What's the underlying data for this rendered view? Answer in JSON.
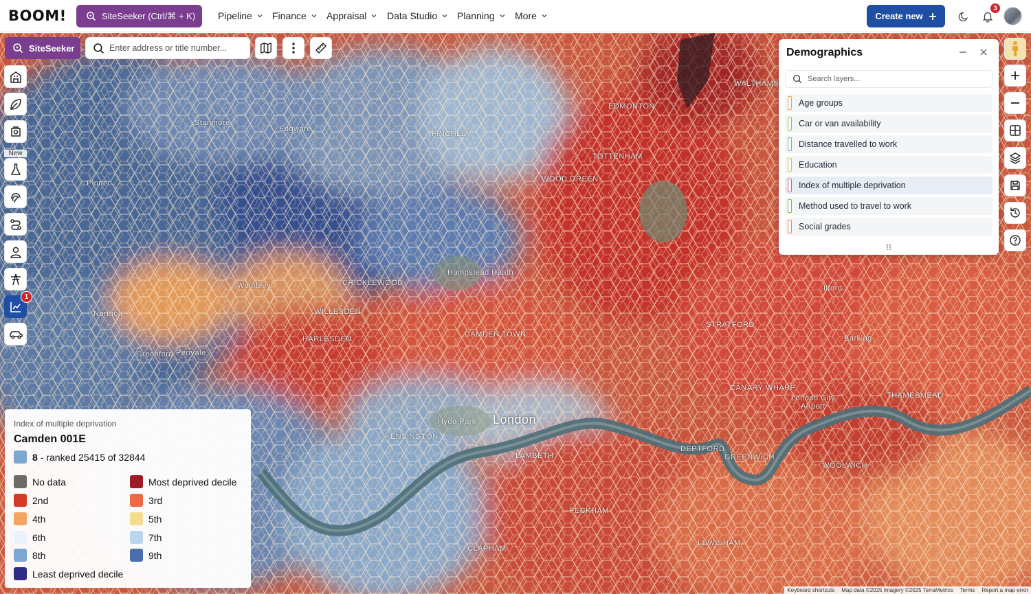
{
  "header": {
    "logo": "BOOM!",
    "siteseeker_button": "SiteSeeker (Ctrl/⌘ + K)",
    "nav": [
      {
        "label": "Pipeline"
      },
      {
        "label": "Finance"
      },
      {
        "label": "Appraisal"
      },
      {
        "label": "Data Studio"
      },
      {
        "label": "Planning"
      },
      {
        "label": "More"
      }
    ],
    "create_button": "Create new",
    "notifications_count": "3"
  },
  "map_toolbar": {
    "siteseeker_label": "SiteSeeker",
    "search_placeholder": "Enter address or title number..."
  },
  "left_rail": {
    "new_label": "New",
    "active_badge": "1"
  },
  "map": {
    "labels": {
      "london": "London",
      "wembley": "Wembley",
      "hyde_park": "Hyde Park",
      "tottenham": "TOTTENHAM",
      "stratford": "STRATFORD",
      "camden_town": "CAMDEN TOWN",
      "edmonton": "EDMONTON",
      "walthamstow": "WALTHAMSTOW",
      "greenwich": "GREENWICH",
      "woolwich": "WOOLWICH",
      "harlesden": "HARLESDEN",
      "willesden": "WILLESDEN",
      "wood_green": "WOOD GREEN",
      "hampstead_heath": "Hampstead Heath",
      "cricklewood": "CRICKLEWOOD",
      "northolt": "Northolt",
      "greenford": "Greenford",
      "perivale": "Perivale",
      "stanmore": "Stanmore",
      "edgware": "Edgware",
      "pinner": "Pinner",
      "finchley": "FINCHLEY",
      "barking": "Barking",
      "ilford": "Ilford",
      "kensington": "KENSINGTON",
      "lambeth": "LAMBETH",
      "deptford": "DEPTFORD",
      "lewisham": "LEWISHAM",
      "clapham": "CLAPHAM",
      "peckham": "PECKHAM",
      "canary_wharf": "CANARY WHARF",
      "city_airport": "London City Airport",
      "thamesmead": "THAMESMEAD"
    },
    "attribution": {
      "shortcuts": "Keyboard shortcuts",
      "data": "Map data ©2025 Imagery ©2025 TerraMetrics",
      "terms": "Terms",
      "report": "Report a map error"
    }
  },
  "demographics_panel": {
    "title": "Demographics",
    "search_placeholder": "Search layers...",
    "layers": [
      {
        "label": "Age groups",
        "color": "#f0a340"
      },
      {
        "label": "Car or van availability",
        "color": "#8cc63f"
      },
      {
        "label": "Distance travelled to work",
        "color": "#5fb89a"
      },
      {
        "label": "Education",
        "color": "#e8b74a"
      },
      {
        "label": "Index of multiple deprivation",
        "color": "#e0605a"
      },
      {
        "label": "Method used to travel to work",
        "color": "#6cc24a"
      },
      {
        "label": "Social grades",
        "color": "#f08a3c"
      }
    ]
  },
  "legend": {
    "subtitle": "Index of multiple deprivation",
    "area": "Camden 001E",
    "decile": "8",
    "rank_text": "- ranked 25415 of 32844",
    "rank_color": "#7ba7d0",
    "items": [
      {
        "label": "No data",
        "color": "#6f6a66"
      },
      {
        "label": "Most deprived decile",
        "color": "#9b1c24"
      },
      {
        "label": "2nd",
        "color": "#d23a2a"
      },
      {
        "label": "3rd",
        "color": "#ec6a44"
      },
      {
        "label": "4th",
        "color": "#f4a561"
      },
      {
        "label": "5th",
        "color": "#f8dc8e"
      },
      {
        "label": "6th",
        "color": "#eaf3fb"
      },
      {
        "label": "7th",
        "color": "#b9d6ee"
      },
      {
        "label": "8th",
        "color": "#7ba7d0"
      },
      {
        "label": "9th",
        "color": "#4a6fae"
      },
      {
        "label": "Least deprived decile",
        "color": "#2e2c86"
      }
    ]
  }
}
